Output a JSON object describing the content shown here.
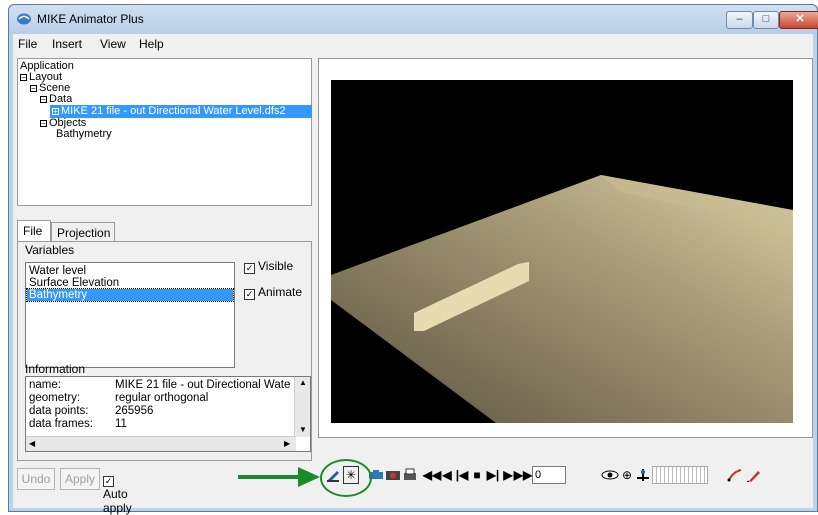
{
  "window": {
    "title": "MIKE Animator Plus",
    "min": "–",
    "max": "□",
    "close": "✕"
  },
  "menu": [
    "File",
    "Insert",
    "View",
    "Help"
  ],
  "tree": {
    "application": "Application",
    "layout": "Layout",
    "scene": "Scene",
    "data": "Data",
    "data_item": "MIKE 21 file - out Directional Water Level.dfs2",
    "objects": "Objects",
    "bathymetry": "Bathymetry"
  },
  "tabs": [
    "File",
    "Projection"
  ],
  "variables": {
    "label": "Variables",
    "items": [
      "Water level",
      "Surface Elevation",
      "Bathymetry"
    ],
    "selected": "Bathymetry",
    "visible_label": "Visible",
    "animate_label": "Animate"
  },
  "information": {
    "label": "Information",
    "rows": [
      {
        "key": "name:",
        "value": "MIKE 21 file - out Directional Wate"
      },
      {
        "key": "geometry:",
        "value": "regular orthogonal"
      },
      {
        "key": "data points:",
        "value": "265956"
      },
      {
        "key": "data frames:",
        "value": "11"
      }
    ]
  },
  "bottom": {
    "undo": "Undo",
    "apply": "Apply",
    "auto_apply": "Auto apply"
  },
  "toolbar": {
    "frame_value": "0"
  },
  "colors": {
    "selection": "#3399ff",
    "highlight_circle": "#1a8a2a",
    "arrow": "#1a8a2a",
    "viewport": "#000000"
  }
}
